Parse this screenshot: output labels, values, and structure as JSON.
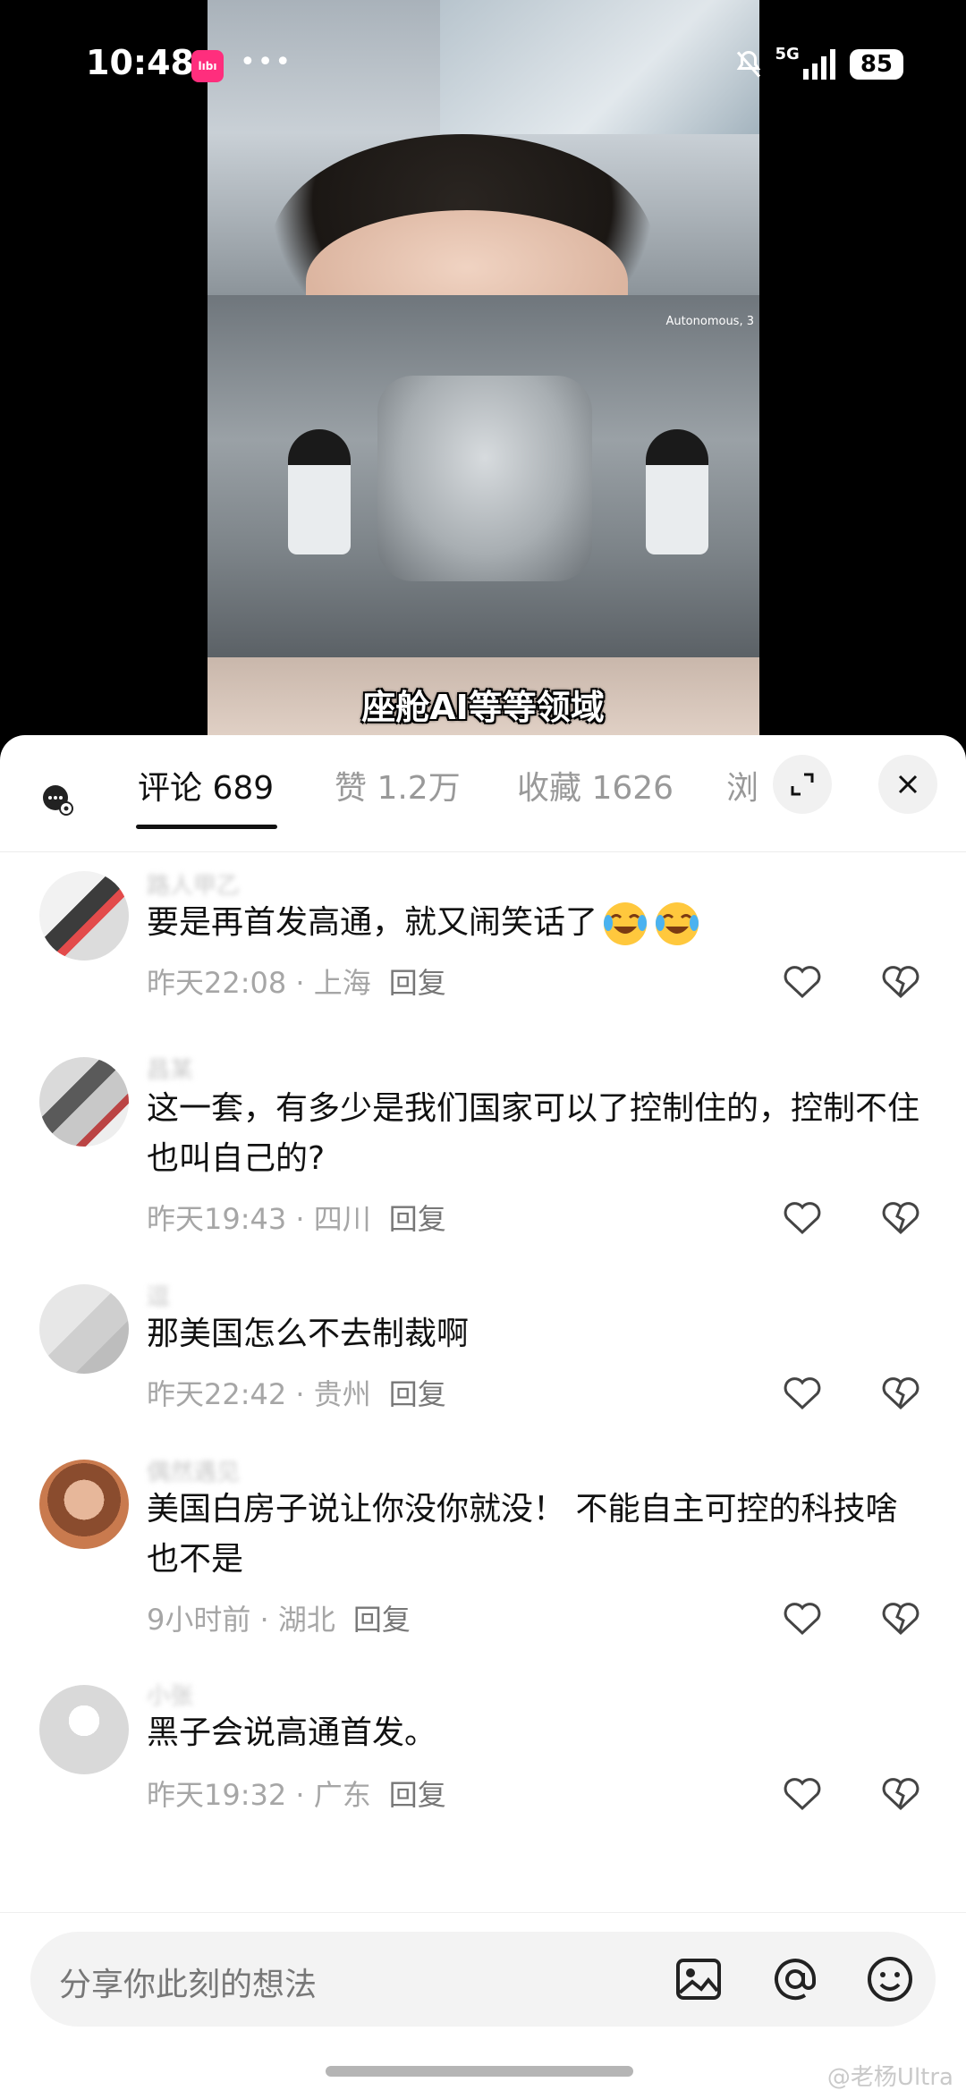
{
  "status_bar": {
    "time": "10:48",
    "app_badge": "lıbı",
    "dots": "•••",
    "network": "5G",
    "battery": "85"
  },
  "video": {
    "overlay_label": "Autonomous, 3",
    "caption": "座舱AI等等领域"
  },
  "tabs": [
    {
      "label": "评论 689",
      "active": true
    },
    {
      "label": "赞 1.2万",
      "active": false
    },
    {
      "label": "收藏 1626",
      "active": false
    },
    {
      "label": "浏",
      "active": false
    }
  ],
  "comments": [
    {
      "username": "路人甲乙",
      "text": "要是再首发高通，就又闹笑话了",
      "emojis": [
        "laughing-crying",
        "laughing-crying"
      ],
      "time": "昨天22:08",
      "location": "上海",
      "reply": "回复"
    },
    {
      "username": "昌某",
      "text": "这一套，有多少是我们国家可以了控制住的，控制不住也叫自己的?",
      "time": "昨天19:43",
      "location": "四川",
      "reply": "回复"
    },
    {
      "username": "逗",
      "text": "那美国怎么不去制裁啊",
      "time": "昨天22:42",
      "location": "贵州",
      "reply": "回复"
    },
    {
      "username": "偶然遇见",
      "text": "美国白房子说让你没你就没！ 不能自主可控的科技啥也不是",
      "time": "9小时前",
      "location": "湖北",
      "reply": "回复"
    },
    {
      "username": "小张",
      "text": "黑子会说高通首发。",
      "time": "昨天19:32",
      "location": "广东",
      "reply": "回复"
    }
  ],
  "input": {
    "placeholder": "分享你此刻的想法"
  },
  "watermark": "@老杨Ultra",
  "colors": {
    "panel_bg": "#ffffff",
    "primary_text": "#111111",
    "secondary_text": "#a6a6a6",
    "input_bg": "#f3f3f3",
    "app_badge": "#ff2e7d"
  }
}
